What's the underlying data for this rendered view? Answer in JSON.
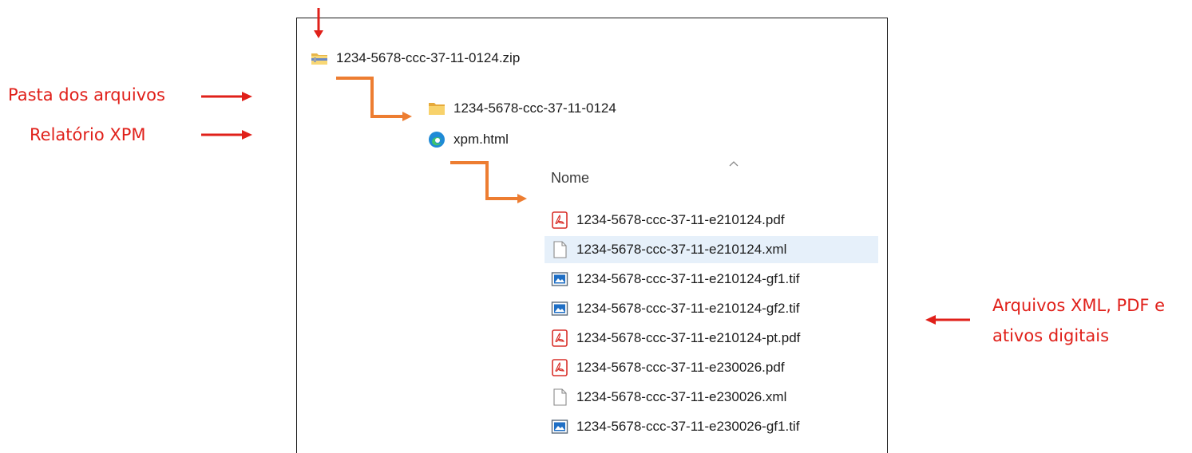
{
  "annotations": {
    "folder_label": "Pasta dos arquivos",
    "report_label": "Relatório XPM",
    "assets_label_line1": "Arquivos XML, PDF e",
    "assets_label_line2": "ativos digitais",
    "color": "#e0201a"
  },
  "explorer": {
    "zip_file": {
      "name": "1234-5678-ccc-37-11-0124.zip",
      "icon": "zip-folder-icon"
    },
    "folder": {
      "name": "1234-5678-ccc-37-11-0124",
      "icon": "folder-icon"
    },
    "report": {
      "name": "xpm.html",
      "icon": "edge-browser-icon"
    },
    "column_header": "Nome",
    "sort_indicator": "chevron-up-icon",
    "files": [
      {
        "name": "1234-5678-ccc-37-11-e210124.pdf",
        "icon": "pdf-icon"
      },
      {
        "name": "1234-5678-ccc-37-11-e210124.xml",
        "icon": "blank-file-icon",
        "selected": true
      },
      {
        "name": "1234-5678-ccc-37-11-e210124-gf1.tif",
        "icon": "image-icon"
      },
      {
        "name": "1234-5678-ccc-37-11-e210124-gf2.tif",
        "icon": "image-icon"
      },
      {
        "name": "1234-5678-ccc-37-11-e210124-pt.pdf",
        "icon": "pdf-icon"
      },
      {
        "name": "1234-5678-ccc-37-11-e230026.pdf",
        "icon": "pdf-icon"
      },
      {
        "name": "1234-5678-ccc-37-11-e230026.xml",
        "icon": "blank-file-icon"
      },
      {
        "name": "1234-5678-ccc-37-11-e230026-gf1.tif",
        "icon": "image-icon"
      }
    ]
  },
  "colors": {
    "connector": "#ed7d31",
    "selection": "#e6f0fa"
  }
}
